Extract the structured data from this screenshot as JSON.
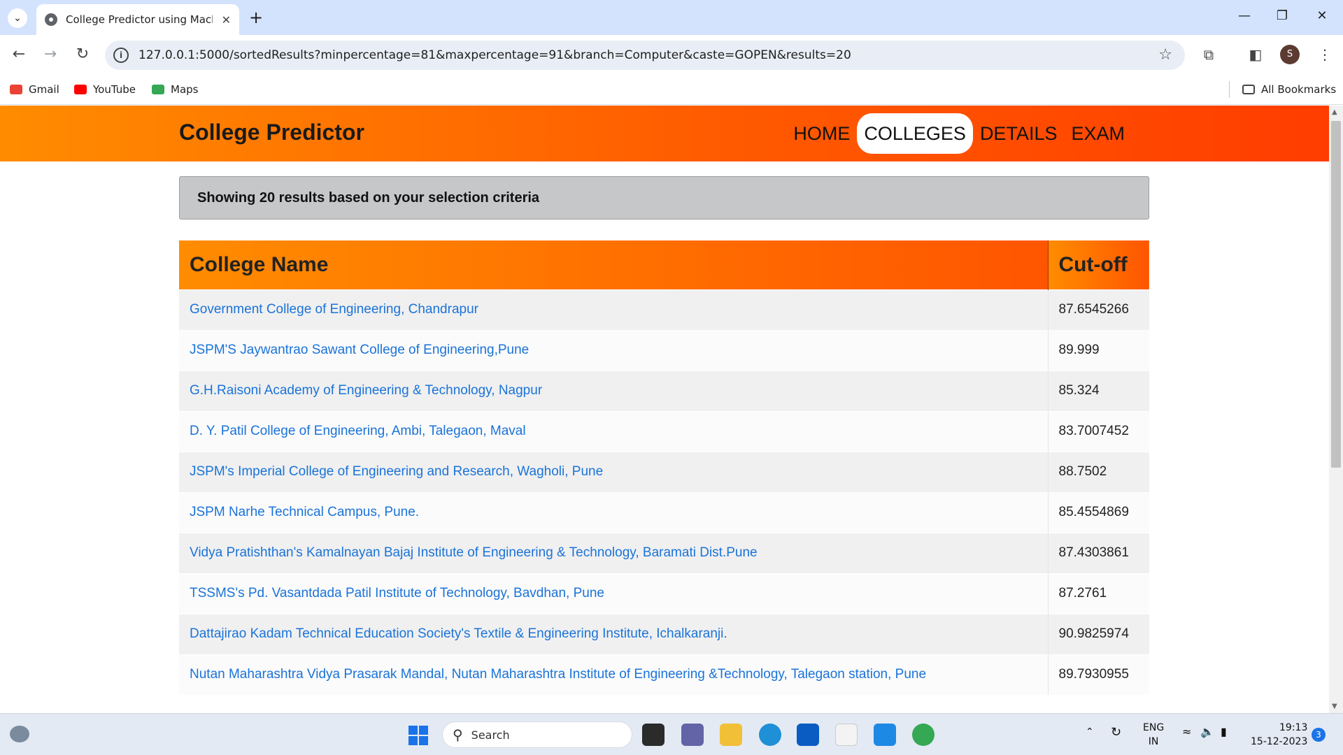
{
  "browser": {
    "tab_title": "College Predictor using Machin",
    "url": "127.0.0.1:5000/sortedResults?minpercentage=81&maxpercentage=91&branch=Computer&caste=GOPEN&results=20",
    "profile_initial": "S",
    "bookmarks": [
      "Gmail",
      "YouTube",
      "Maps"
    ],
    "all_bookmarks": "All Bookmarks"
  },
  "site": {
    "brand": "College Predictor",
    "nav": [
      "HOME",
      "COLLEGES",
      "DETAILS",
      "EXAM"
    ],
    "active_nav": "COLLEGES",
    "info": "Showing 20 results based on your selection criteria"
  },
  "table": {
    "headers": [
      "College Name",
      "Cut-off"
    ],
    "rows": [
      {
        "name": "Government College of Engineering, Chandrapur",
        "cutoff": "87.6545266"
      },
      {
        "name": "JSPM'S Jaywantrao Sawant College of Engineering,Pune",
        "cutoff": "89.999"
      },
      {
        "name": "G.H.Raisoni Academy of Engineering & Technology, Nagpur",
        "cutoff": "85.324"
      },
      {
        "name": "D. Y. Patil College of Engineering, Ambi, Talegaon, Maval",
        "cutoff": "83.7007452"
      },
      {
        "name": "JSPM's Imperial College of Engineering and Research, Wagholi, Pune",
        "cutoff": "88.7502"
      },
      {
        "name": "JSPM Narhe Technical Campus, Pune.",
        "cutoff": "85.4554869"
      },
      {
        "name": "Vidya Pratishthan's Kamalnayan Bajaj Institute of Engineering & Technology, Baramati Dist.Pune",
        "cutoff": "87.4303861"
      },
      {
        "name": "TSSMS's Pd. Vasantdada Patil Institute of Technology, Bavdhan, Pune",
        "cutoff": "87.2761"
      },
      {
        "name": "Dattajirao Kadam Technical Education Society's Textile & Engineering Institute, Ichalkaranji.",
        "cutoff": "90.9825974"
      },
      {
        "name": "Nutan Maharashtra Vidya Prasarak Mandal, Nutan Maharashtra Institute of Engineering &Technology, Talegaon station, Pune",
        "cutoff": "89.7930955"
      }
    ]
  },
  "taskbar": {
    "search_placeholder": "Search",
    "lang": "ENG",
    "region": "IN",
    "time": "19:13",
    "date": "15-12-2023",
    "notification_count": "3"
  }
}
